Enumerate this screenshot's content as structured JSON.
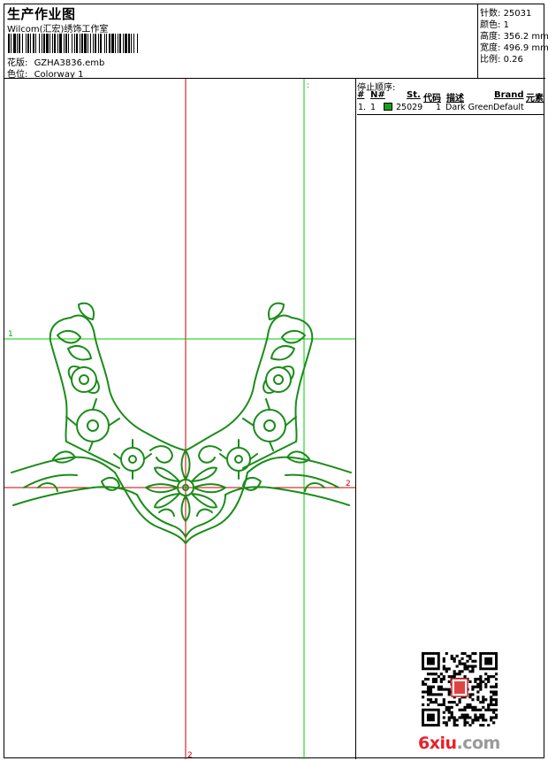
{
  "header": {
    "title": "生产作业图",
    "company": "Wilcom(汇宏)绣饰工作室",
    "pattern_label": "花版:",
    "pattern_value": "GZHA3836.emb",
    "colorway_label": "色位:",
    "colorway_value": "Colorway 1"
  },
  "stats": [
    {
      "label": "针数:",
      "value": "25031"
    },
    {
      "label": "颜色:",
      "value": "1"
    },
    {
      "label": "高度:",
      "value": "356.2 mm"
    },
    {
      "label": "宽度:",
      "value": "496.9 mm"
    },
    {
      "label": "比例:",
      "value": "0.26"
    }
  ],
  "stop_sequence": {
    "title": "停止顺序:",
    "columns": [
      "#",
      "N#",
      "St.",
      "代码",
      "描述",
      "Brand",
      "元素"
    ],
    "rows": [
      {
        "num": "1.",
        "needle": "1",
        "stitches": "25029",
        "code": "1",
        "description": "Dark Green",
        "brand": "Default",
        "color": "#1a9e1a"
      }
    ]
  },
  "guides": {
    "marker_1": "1",
    "marker_2": "2",
    "marker_3": "2",
    "marker_dot": ":"
  },
  "watermark": {
    "site_red": "6xiu",
    "site_gray": ".com"
  },
  "colors": {
    "stitch": "#1a8c1a",
    "guide_red": "#cc0000",
    "guide_green": "#00cc00"
  }
}
